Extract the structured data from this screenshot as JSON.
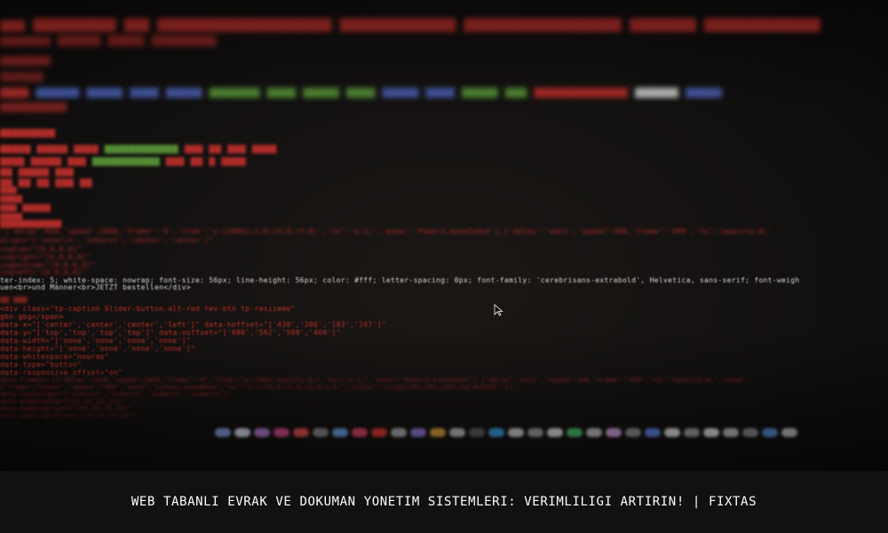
{
  "caption": {
    "text": "WEB TABANLI EVRAK VE DOKUMAN YONETIM SISTEMLERI: VERIMLILIGI ARTIRIN! | FIXTAS"
  },
  "code_lines": [
    {
      "text": "<div class=\"tp-caption Slider-button-alt-red rev-btn tp-resizeme\"",
      "cls": "red blur-md"
    },
    {
      "text": "          data-whitespace=\"nowrap\"",
      "cls": "red blur-md"
    },
    {
      "text": "gbn-gbg</span>",
      "cls": "red blur-lo"
    },
    {
      "text": "gueno-dv",
      "cls": "red blur-lo"
    },
    {
      "text": "  data-x=\"['center','center','center','left']\" data-hoffset=\"['430','206','183','247']\"",
      "cls": "red blur-lo"
    },
    {
      "text": "  data-y=\"['top','top','top','top']\" data-voffset=\"['680','562','589','460']\"",
      "cls": "red blur-lo"
    },
    {
      "text": "  data-width=\"['none','none','none','none']\"",
      "cls": "red blur-lo"
    },
    {
      "text": "  data-height=\"['none','none','none','none']\"",
      "cls": "red blur-lo"
    },
    {
      "text": "  data-type=\"button\"",
      "cls": "red blur-lo"
    },
    {
      "text": "  data-responsive_offset=\"on\"",
      "cls": "red blur-lo"
    },
    {
      "text": "  data-frames='[{\"delay\":1410,\"speed\":2000,\"frame\":\"0\",\"from\":\"x:-50px;opacity:0;\",\"to\":\"o:1;\",\"ease\":\"Power3.easeInOut\"},{\"delay\":\"wait\",\"speed\":300,\"frame\":\"999\",\"to\":\"opacity:0;\",\"ease\"",
      "cls": "red blur-xlo"
    },
    {
      "text": "      {\"frame\":\"hover\",\"speed\":\"300\",\"ease\":\"Linear.easeNone\",\"to\":\"o:1;rX:0;rY:0;rZ:0;z:0;\",\"style\":\"c:rgb(255,255,255);bg:#c0392;\"}]'",
      "cls": "red blur-xlo"
    },
    {
      "text": "  data-textAlign=\"['inherit','inherit','inherit','inherit']\"",
      "cls": "red blur-xlo"
    },
    {
      "text": "  data-paddingtop=\"[12,12,12,12]\"",
      "cls": "red blur-xlo"
    },
    {
      "text": "  data-paddingright=\"[35,35,35,35]\"",
      "cls": "red blur-xlo"
    },
    {
      "text": "  data-paddingbottom=\"[10,10,10,10]\"",
      "cls": "red blur-xlo"
    },
    {
      "text": "  data-paddingleft=\"[35,35,35,35]\"",
      "cls": "red blur-xlo"
    }
  ],
  "code_mid": [
    {
      "text": "ter-index: 5; white-space: nowrap; font-size: 56px; line-height: 56px; color: #fff; letter-spacing: 0px; font-family: 'cerebrisans-extrabold', Helvetica, sans-serif; font-weigh",
      "cls": "white blur-lo"
    },
    {
      "text": "uen<br>und Männer<br>JETZT bestellen</div>",
      "cls": "white blur-lo"
    }
  ],
  "code_upper": [
    {
      "text": "\"['delay':930,'speed':2000,'frame':'0','from':'y:[100%];z:0;rX:0;rY:0;','to':'o:1;','ease':'Power3.easeInOut'},{'delay':'wait','speed':300,'frame':'999','to':'opacity:0;'",
      "cls": "red blur-md"
    },
    {
      "text": "align=\"['inherit','inherit','center','center']\"",
      "cls": "red blur-md"
    },
    {
      "text": "ingtop=\"[0,0,0,0]\"",
      "cls": "red blur-md"
    },
    {
      "text": "ingright=\"[0,0,0,0]\"",
      "cls": "red blur-md"
    },
    {
      "text": "ingbottom=\"[0,0,0,0]\"",
      "cls": "red blur-md"
    },
    {
      "text": "ingleft=\"[0,0,0,0]\"",
      "cls": "red blur-md"
    }
  ]
}
